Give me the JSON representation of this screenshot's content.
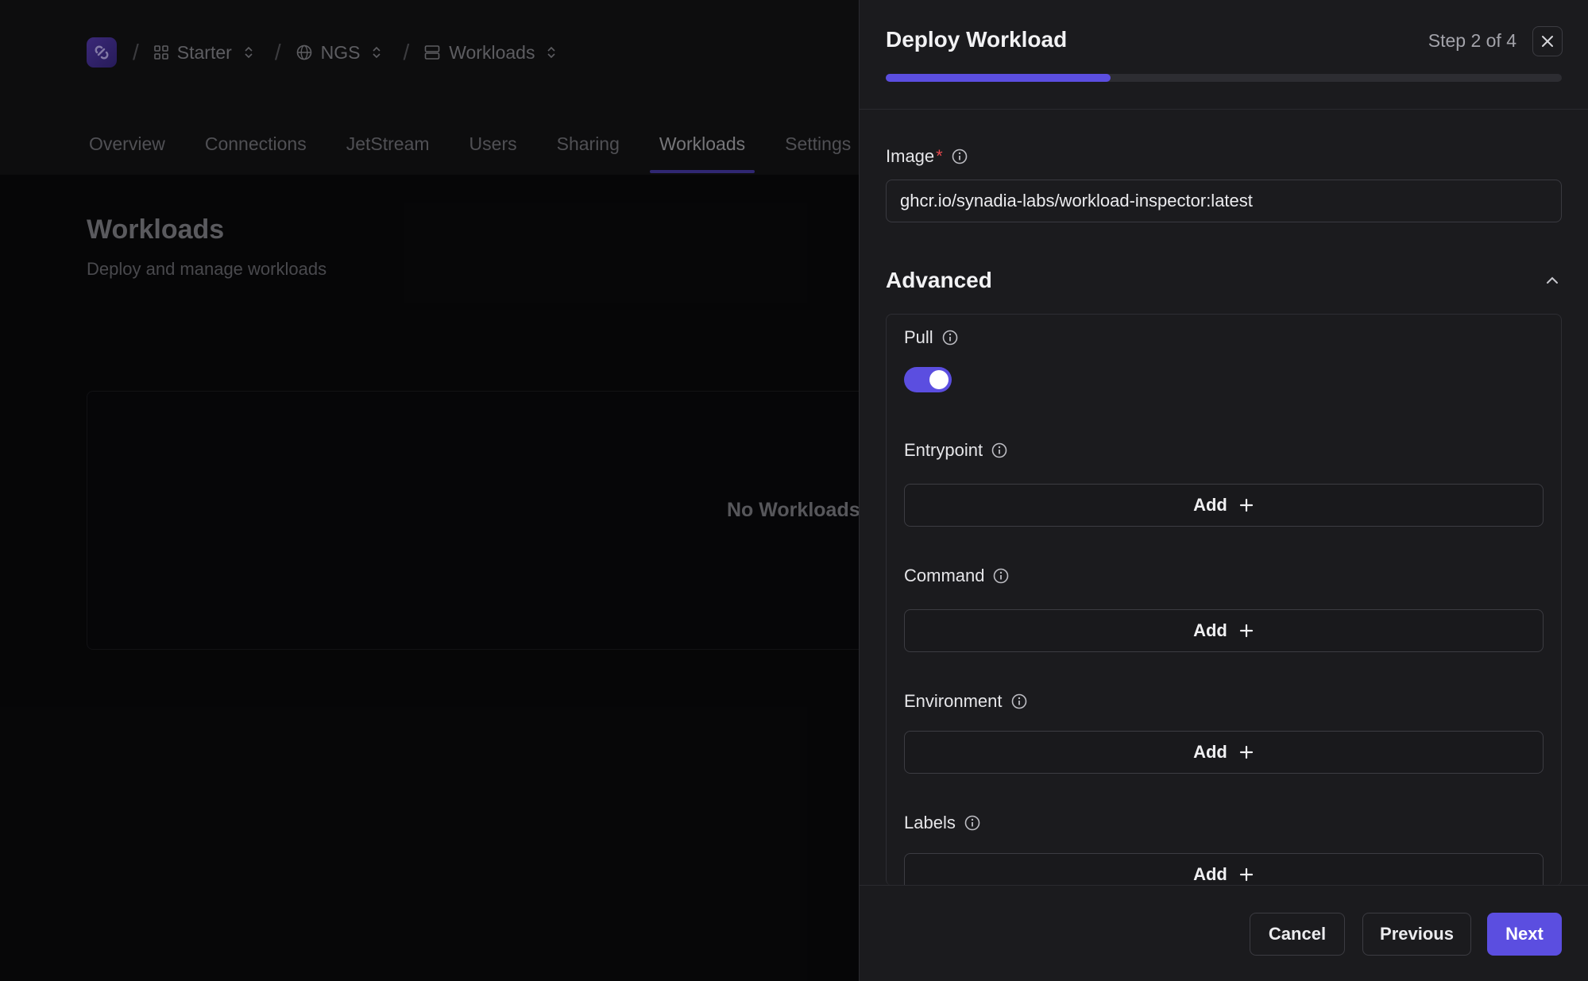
{
  "breadcrumb": {
    "items": [
      {
        "label": "Starter",
        "icon": "grid-icon"
      },
      {
        "label": "NGS",
        "icon": "globe-icon"
      },
      {
        "label": "Workloads",
        "icon": "server-icon"
      }
    ]
  },
  "tabs": [
    {
      "label": "Overview"
    },
    {
      "label": "Connections"
    },
    {
      "label": "JetStream"
    },
    {
      "label": "Users"
    },
    {
      "label": "Sharing"
    },
    {
      "label": "Workloads",
      "active": true
    },
    {
      "label": "Settings"
    }
  ],
  "page": {
    "title": "Workloads",
    "subtitle": "Deploy and manage workloads",
    "empty_message": "No Workloads"
  },
  "drawer": {
    "title": "Deploy Workload",
    "step_label": "Step 2 of 4",
    "progress": 0.333,
    "image": {
      "label": "Image",
      "required_marker": "*",
      "value": "ghcr.io/synadia-labs/workload-inspector:latest"
    },
    "advanced": {
      "title": "Advanced",
      "expanded": true,
      "pull": {
        "label": "Pull",
        "enabled": true
      },
      "entrypoint": {
        "label": "Entrypoint",
        "button": "Add"
      },
      "command": {
        "label": "Command",
        "button": "Add"
      },
      "environment": {
        "label": "Environment",
        "button": "Add"
      },
      "labels": {
        "label": "Labels",
        "button": "Add"
      }
    },
    "footer": {
      "cancel": "Cancel",
      "previous": "Previous",
      "next": "Next"
    }
  },
  "colors": {
    "accent": "#5b4ee0",
    "required": "#e5484d",
    "drawer_bg": "#1b1b1e",
    "page_bg": "#0a0a0c"
  }
}
